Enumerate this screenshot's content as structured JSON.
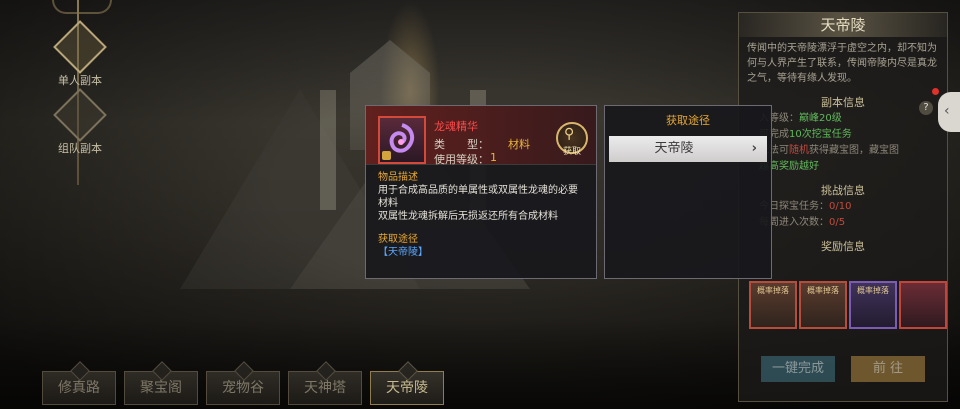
{
  "side_nav": {
    "items": [
      {
        "label": "单人副本"
      },
      {
        "label": "组队副本"
      }
    ]
  },
  "map_tabs": [
    "修真路",
    "聚宝阁",
    "宠物谷",
    "天神塔",
    "天帝陵"
  ],
  "right_panel": {
    "title": "天帝陵",
    "description": "传闻中的天帝陵漂浮于虚空之内，却不知为何与人界产生了联系，传闻帝陵内尽是真龙之气，等待有缘人发现。",
    "section_dungeon": "副本信息",
    "level_label": "入等级：",
    "level_value": "巅峰20级",
    "condition_prefix": "可完成",
    "condition_value": "10次挖宝任务",
    "play_prefix": "玩法可",
    "play_random": "随机",
    "play_rest": "获得藏宝图，藏宝图",
    "play_reward": "越高奖励越好",
    "section_challenge": "挑战信息",
    "daily_treasure_label": "今日探宝任务：",
    "daily_treasure_value": "0/10",
    "daily_entry_label": "每周进入次数：",
    "daily_entry_value": "0/5",
    "section_reward": "奖励信息",
    "reward_labels": [
      "概率掉落",
      "概率掉落",
      "概率掉落",
      ""
    ],
    "btn_onekey": "一键完成",
    "btn_go": "前 往"
  },
  "item_tooltip": {
    "name": "龙魂精华",
    "type_label": "类　　型：",
    "type_value": "材料",
    "level_label": "使用等级：",
    "level_value": "1",
    "search_label": "获取",
    "desc_title": "物品描述",
    "desc_line1": "用于合成高品质的单属性或双属性龙魂的必要材料",
    "desc_line2": "双属性龙魂拆解后无损返还所有合成材料",
    "source_title": "获取途径",
    "source_link": "【天帝陵】"
  },
  "acquire_panel": {
    "title": "获取途径",
    "button_label": "天帝陵"
  },
  "colors": {
    "item_name": "#ff4a4a",
    "highlight": "#e8b43a",
    "link": "#5aa8ff"
  }
}
